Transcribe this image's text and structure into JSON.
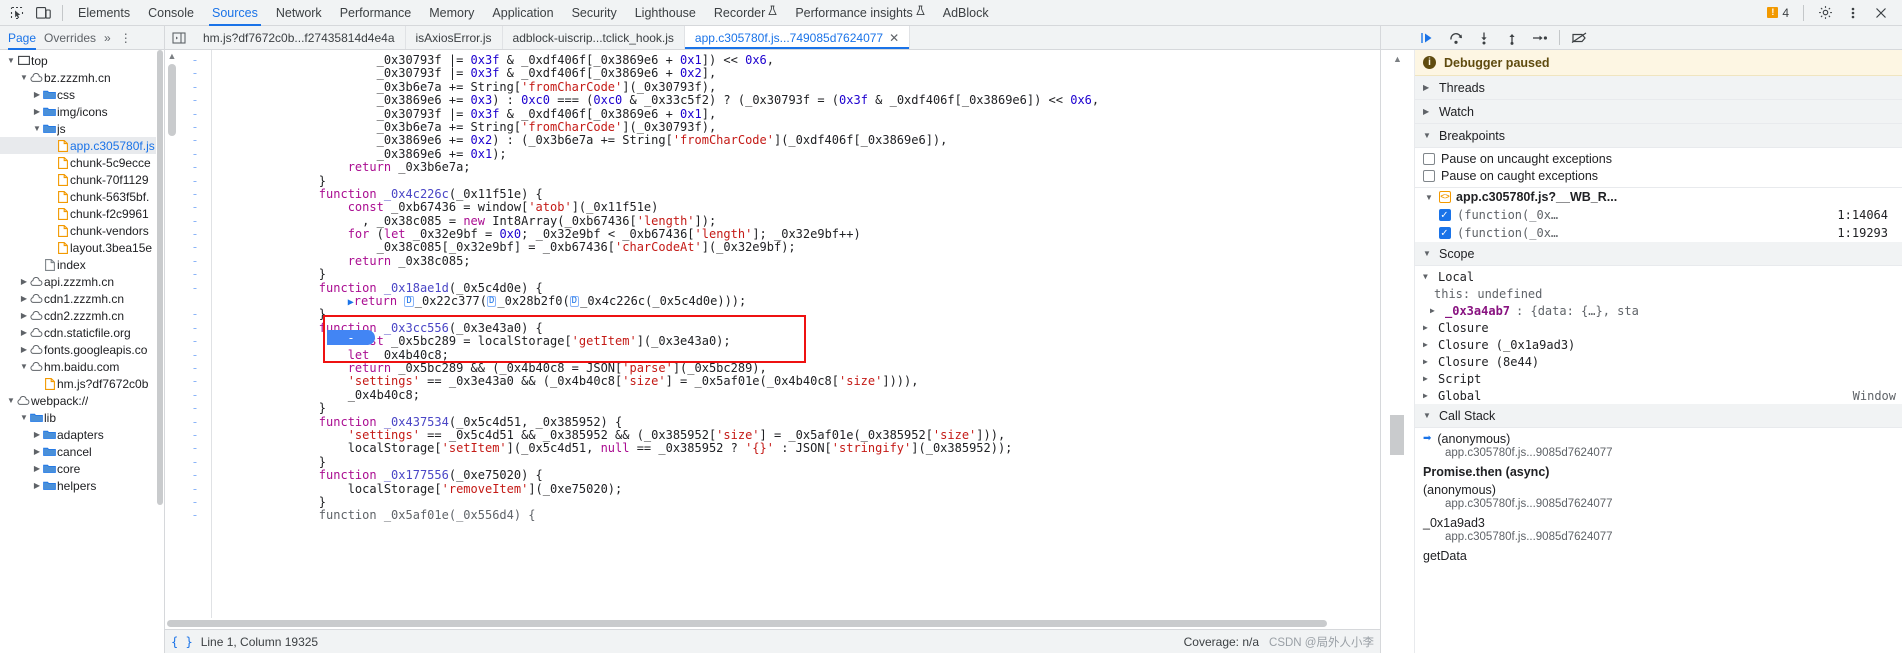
{
  "toolbar": {
    "inspect_icon": "inspect-element-icon",
    "device_icon": "device-toolbar-icon",
    "tabs": [
      {
        "label": "Elements",
        "active": false,
        "flask": false
      },
      {
        "label": "Console",
        "active": false,
        "flask": false
      },
      {
        "label": "Sources",
        "active": true,
        "flask": false
      },
      {
        "label": "Network",
        "active": false,
        "flask": false
      },
      {
        "label": "Performance",
        "active": false,
        "flask": false
      },
      {
        "label": "Memory",
        "active": false,
        "flask": false
      },
      {
        "label": "Application",
        "active": false,
        "flask": false
      },
      {
        "label": "Security",
        "active": false,
        "flask": false
      },
      {
        "label": "Lighthouse",
        "active": false,
        "flask": false
      },
      {
        "label": "Recorder",
        "active": false,
        "flask": true
      },
      {
        "label": "Performance insights",
        "active": false,
        "flask": true
      },
      {
        "label": "AdBlock",
        "active": false,
        "flask": false
      }
    ],
    "warning_count": "4",
    "settings_icon": "gear-icon",
    "more_icon": "more-vertical-icon",
    "close_icon": "close-icon"
  },
  "navbar": {
    "page_tab": "Page",
    "overrides_tab": "Overrides",
    "more": "»",
    "dots": "⋮",
    "panel_toggle_icon": "toggle-navigator-icon"
  },
  "editor_tabs": [
    {
      "label": "hm.js?df7672c0b...f27435814d4e4a",
      "active": false,
      "closable": false
    },
    {
      "label": "isAxiosError.js",
      "active": false,
      "closable": false
    },
    {
      "label": "adblock-uiscrip...tclick_hook.js",
      "active": false,
      "closable": false
    },
    {
      "label": "app.c305780f.js...749085d7624077",
      "active": true,
      "closable": true,
      "close": "✕"
    }
  ],
  "debug_toolbar": {
    "buttons": [
      {
        "name": "resume-script-button",
        "glyph": "▶"
      },
      {
        "name": "step-over-button",
        "glyph": "↷"
      },
      {
        "name": "step-into-button",
        "glyph": "↓"
      },
      {
        "name": "step-out-button",
        "glyph": "↑"
      },
      {
        "name": "step-button",
        "glyph": "→"
      },
      {
        "name": "deactivate-breakpoints-button",
        "glyph": "⊘"
      }
    ]
  },
  "file_tree": [
    {
      "depth": 0,
      "arrow": "▼",
      "icon": "frame-icon",
      "label": "top",
      "selected": false,
      "blue": false
    },
    {
      "depth": 1,
      "arrow": "▼",
      "icon": "cloud-icon",
      "label": "bz.zzzmh.cn",
      "selected": false,
      "blue": false
    },
    {
      "depth": 2,
      "arrow": "▶",
      "icon": "folder-icon",
      "label": "css",
      "selected": false,
      "blue": false
    },
    {
      "depth": 2,
      "arrow": "▶",
      "icon": "folder-icon",
      "label": "img/icons",
      "selected": false,
      "blue": false
    },
    {
      "depth": 2,
      "arrow": "▼",
      "icon": "folder-icon",
      "label": "js",
      "selected": false,
      "blue": false
    },
    {
      "depth": 3,
      "arrow": "",
      "icon": "js-file-icon",
      "label": "app.c305780f.js",
      "selected": true,
      "blue": true
    },
    {
      "depth": 3,
      "arrow": "",
      "icon": "js-file-icon",
      "label": "chunk-5c9ecce",
      "selected": false,
      "blue": false
    },
    {
      "depth": 3,
      "arrow": "",
      "icon": "js-file-icon",
      "label": "chunk-70f1129",
      "selected": false,
      "blue": false
    },
    {
      "depth": 3,
      "arrow": "",
      "icon": "js-file-icon",
      "label": "chunk-563f5bf.",
      "selected": false,
      "blue": false
    },
    {
      "depth": 3,
      "arrow": "",
      "icon": "js-file-icon",
      "label": "chunk-f2c9961",
      "selected": false,
      "blue": false
    },
    {
      "depth": 3,
      "arrow": "",
      "icon": "js-file-icon",
      "label": "chunk-vendors",
      "selected": false,
      "blue": false
    },
    {
      "depth": 3,
      "arrow": "",
      "icon": "js-file-icon",
      "label": "layout.3bea15e",
      "selected": false,
      "blue": false
    },
    {
      "depth": 2,
      "arrow": "",
      "icon": "doc-file-icon",
      "label": "index",
      "selected": false,
      "blue": false
    },
    {
      "depth": 1,
      "arrow": "▶",
      "icon": "cloud-icon",
      "label": "api.zzzmh.cn",
      "selected": false,
      "blue": false
    },
    {
      "depth": 1,
      "arrow": "▶",
      "icon": "cloud-icon",
      "label": "cdn1.zzzmh.cn",
      "selected": false,
      "blue": false
    },
    {
      "depth": 1,
      "arrow": "▶",
      "icon": "cloud-icon",
      "label": "cdn2.zzzmh.cn",
      "selected": false,
      "blue": false
    },
    {
      "depth": 1,
      "arrow": "▶",
      "icon": "cloud-icon",
      "label": "cdn.staticfile.org",
      "selected": false,
      "blue": false
    },
    {
      "depth": 1,
      "arrow": "▶",
      "icon": "cloud-icon",
      "label": "fonts.googleapis.co",
      "selected": false,
      "blue": false
    },
    {
      "depth": 1,
      "arrow": "▼",
      "icon": "cloud-icon",
      "label": "hm.baidu.com",
      "selected": false,
      "blue": false
    },
    {
      "depth": 2,
      "arrow": "",
      "icon": "js-file-icon",
      "label": "hm.js?df7672c0b",
      "selected": false,
      "blue": false
    },
    {
      "depth": 0,
      "arrow": "▼",
      "icon": "cloud-icon",
      "label": "webpack://",
      "selected": false,
      "blue": false
    },
    {
      "depth": 1,
      "arrow": "▼",
      "icon": "folder-icon",
      "label": "lib",
      "selected": false,
      "blue": false
    },
    {
      "depth": 2,
      "arrow": "▶",
      "icon": "folder-icon",
      "label": "adapters",
      "selected": false,
      "blue": false
    },
    {
      "depth": 2,
      "arrow": "▶",
      "icon": "folder-icon",
      "label": "cancel",
      "selected": false,
      "blue": false
    },
    {
      "depth": 2,
      "arrow": "▶",
      "icon": "folder-icon",
      "label": "core",
      "selected": false,
      "blue": false
    },
    {
      "depth": 2,
      "arrow": "▶",
      "icon": "folder-icon",
      "label": "helpers",
      "selected": false,
      "blue": false
    }
  ],
  "code_lines": [
    {
      "marker": "-",
      "html": "                <span class='pln'>_0x30793f |= </span><span class='num'>0x3f</span><span class='pln'> &amp; _0xdf406f[_0x3869e6 + </span><span class='num'>0x1</span><span class='pln'>]) &lt;&lt; </span><span class='num'>0x6</span><span class='pln'>,</span>"
    },
    {
      "marker": "-",
      "html": "                <span class='pln'>_0x30793f |= </span><span class='num'>0x3f</span><span class='pln'> &amp; _0xdf406f[_0x3869e6 + </span><span class='num'>0x2</span><span class='pln'>],</span>"
    },
    {
      "marker": "-",
      "html": "                <span class='pln'>_0x3b6e7a += String[</span><span class='str'>'fromCharCode'</span><span class='pln'>](_0x30793f),</span>"
    },
    {
      "marker": "-",
      "html": "                <span class='pln'>_0x3869e6 += </span><span class='num'>0x3</span><span class='pln'>) : </span><span class='num'>0xc0</span><span class='pln'> === (</span><span class='num'>0xc0</span><span class='pln'> &amp; _0x33c5f2) ? (_0x30793f = (</span><span class='num'>0x3f</span><span class='pln'> &amp; _0xdf406f[_0x3869e6]) &lt;&lt; </span><span class='num'>0x6</span><span class='pln'>,</span>"
    },
    {
      "marker": "-",
      "html": "                <span class='pln'>_0x30793f |= </span><span class='num'>0x3f</span><span class='pln'> &amp; _0xdf406f[_0x3869e6 + </span><span class='num'>0x1</span><span class='pln'>],</span>"
    },
    {
      "marker": "-",
      "html": "                <span class='pln'>_0x3b6e7a += String[</span><span class='str'>'fromCharCode'</span><span class='pln'>](_0x30793f),</span>"
    },
    {
      "marker": "-",
      "html": "                <span class='pln'>_0x3869e6 += </span><span class='num'>0x2</span><span class='pln'>) : (_0x3b6e7a += String[</span><span class='str'>'fromCharCode'</span><span class='pln'>](_0xdf406f[_0x3869e6]),</span>"
    },
    {
      "marker": "-",
      "html": "                <span class='pln'>_0x3869e6 += </span><span class='num'>0x1</span><span class='pln'>);</span>"
    },
    {
      "marker": "-",
      "html": "            <span class='kw'>return</span><span class='pln'> _0x3b6e7a;</span>"
    },
    {
      "marker": "-",
      "html": "        <span class='pln'>}</span>"
    },
    {
      "marker": "-",
      "html": "        <span class='kw'>function</span><span class='fn'> _0x4c226c</span><span class='pln'>(_0x11f51e) {</span>"
    },
    {
      "marker": "-",
      "html": "            <span class='kw'>const</span><span class='pln'> _0xb67436 = window[</span><span class='str'>'atob'</span><span class='pln'>](_0x11f51e)</span>"
    },
    {
      "marker": "-",
      "html": "              <span class='pln'>, _0x38c085 = </span><span class='kw'>new</span><span class='pln'> Int8Array(_0xb67436[</span><span class='str'>'length'</span><span class='pln'>]);</span>"
    },
    {
      "marker": "-",
      "html": "            <span class='kw'>for</span><span class='pln'> (</span><span class='kw'>let</span><span class='pln'> _0x32e9bf = </span><span class='num'>0x0</span><span class='pln'>; _0x32e9bf &lt; _0xb67436[</span><span class='str'>'length'</span><span class='pln'>]; _0x32e9bf++)</span>"
    },
    {
      "marker": "-",
      "html": "                <span class='pln'>_0x38c085[_0x32e9bf] = _0xb67436[</span><span class='str'>'charCodeAt'</span><span class='pln'>](_0x32e9bf);</span>"
    },
    {
      "marker": "-",
      "html": "            <span class='kw'>return</span><span class='pln'> _0x38c085;</span>"
    },
    {
      "marker": "-",
      "html": "        <span class='pln'>}</span>"
    },
    {
      "marker": "-",
      "html": "        <span class='kw'>function</span><span class='fn'> _0x18ae1d</span><span class='pln'>(_0x5c4d0e) {</span>"
    },
    {
      "marker": "bp",
      "html": "            <span class='blue-tri'>▶</span><span class='kw'>return</span><span class='pln'> </span><span class='d-badge'>D</span><span class='pln'>_0x22c377(</span><span class='d-badge'>D</span><span class='pln'>_0x28b2f0(</span><span class='d-badge'>D</span><span class='pln'>_0x4c226c(_0x5c4d0e)));</span>"
    },
    {
      "marker": "-",
      "html": "        <span class='pln'>}</span>"
    },
    {
      "marker": "-",
      "html": "        <span class='kw'>function</span><span class='fn'> _0x3cc556</span><span class='pln'>(_0x3e43a0) {</span>"
    },
    {
      "marker": "-",
      "html": "            <span class='kw'>const</span><span class='pln'> _0x5bc289 = localStorage[</span><span class='str'>'getItem'</span><span class='pln'>](_0x3e43a0);</span>"
    },
    {
      "marker": "-",
      "html": "            <span class='kw'>let</span><span class='pln'> _0x4b40c8;</span>"
    },
    {
      "marker": "-",
      "html": "            <span class='kw'>return</span><span class='pln'> _0x5bc289 &amp;&amp; (_0x4b40c8 = JSON[</span><span class='str'>'parse'</span><span class='pln'>](_0x5bc289),</span>"
    },
    {
      "marker": "-",
      "html": "            <span class='str'>'settings'</span><span class='pln'> == _0x3e43a0 &amp;&amp; (_0x4b40c8[</span><span class='str'>'size'</span><span class='pln'>] = _0x5af01e(_0x4b40c8[</span><span class='str'>'size'</span><span class='pln'>]))),</span>"
    },
    {
      "marker": "-",
      "html": "            <span class='pln'>_0x4b40c8;</span>"
    },
    {
      "marker": "-",
      "html": "        <span class='pln'>}</span>"
    },
    {
      "marker": "-",
      "html": "        <span class='kw'>function</span><span class='fn'> _0x437534</span><span class='pln'>(_0x5c4d51, _0x385952) {</span>"
    },
    {
      "marker": "-",
      "html": "            <span class='str'>'settings'</span><span class='pln'> == _0x5c4d51 &amp;&amp; _0x385952 &amp;&amp; (_0x385952[</span><span class='str'>'size'</span><span class='pln'>] = _0x5af01e(_0x385952[</span><span class='str'>'size'</span><span class='pln'>])),</span>"
    },
    {
      "marker": "-",
      "html": "            <span class='pln'>localStorage[</span><span class='str'>'setItem'</span><span class='pln'>](_0x5c4d51, </span><span class='kw'>null</span><span class='pln'> == _0x385952 ? </span><span class='str'>'{}'</span><span class='pln'> : JSON[</span><span class='str'>'stringify'</span><span class='pln'>](_0x385952));</span>"
    },
    {
      "marker": "-",
      "html": "        <span class='pln'>}</span>"
    },
    {
      "marker": "-",
      "html": "        <span class='kw'>function</span><span class='fn'> _0x177556</span><span class='pln'>(_0xe75020) {</span>"
    },
    {
      "marker": "-",
      "html": "            <span class='pln'>localStorage[</span><span class='str'>'removeItem'</span><span class='pln'>](_0xe75020);</span>"
    },
    {
      "marker": "-",
      "html": "        <span class='pln'>}</span>"
    },
    {
      "marker": "-",
      "html": "        <span class='dim'>function _0x5af01e(_0x556d4) {</span>"
    }
  ],
  "status": {
    "format_icon": "pretty-print-icon",
    "cursor": "Line 1, Column 19325",
    "coverage": "Coverage: n/a",
    "watermark": "CSDN @局外人小李"
  },
  "debugger": {
    "paused_title": "Debugger paused",
    "sections": {
      "threads": "Threads",
      "watch": "Watch",
      "breakpoints": "Breakpoints",
      "scope": "Scope",
      "call_stack": "Call Stack"
    },
    "pause_uncaught": "Pause on uncaught exceptions",
    "pause_caught": "Pause on caught exceptions",
    "bp_file": "app.c305780f.js?__WB_R...",
    "bp_items": [
      {
        "label": "(function(_0x…",
        "location": "1:14064",
        "checked": true
      },
      {
        "label": "(function(_0x…",
        "location": "1:19293",
        "checked": true
      }
    ],
    "scope": {
      "local": "Local",
      "this": "this: undefined",
      "var1": "_0x3a4ab7",
      "var1_value": ": {data: {…}, sta",
      "closure": "Closure",
      "closure1": "Closure (_0x1a9ad3)",
      "closure2": "Closure (8e44)",
      "script": "Script",
      "global": "Global",
      "global_value": "Window"
    },
    "call_stack": [
      {
        "name": "(anonymous)",
        "file": "app.c305780f.js...9085d7624077",
        "current": true
      },
      {
        "name": "Promise.then (async)",
        "file": "",
        "current": false,
        "async": true
      },
      {
        "name": "(anonymous)",
        "file": "app.c305780f.js...9085d7624077",
        "current": false
      },
      {
        "name": "_0x1a9ad3",
        "file": "app.c305780f.js...9085d7624077",
        "current": false
      },
      {
        "name": "getData",
        "file": "",
        "current": false
      }
    ]
  },
  "colors": {
    "accent": "#1a73e8",
    "paused_bg": "#fdf6e3",
    "highlight_box": "#ee1111",
    "warn": "#f29900"
  }
}
